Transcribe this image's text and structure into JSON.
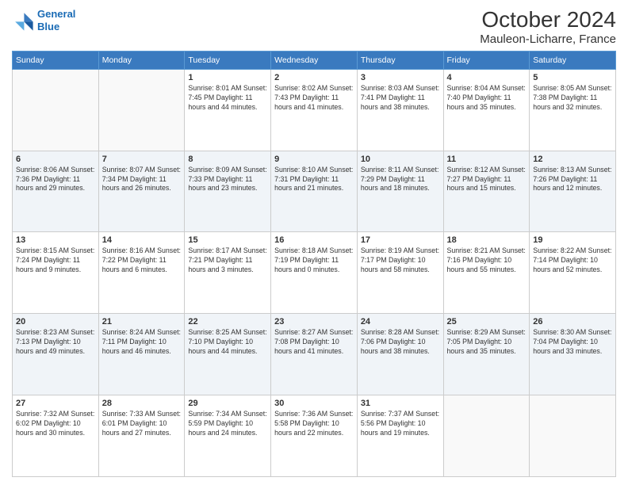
{
  "logo": {
    "line1": "General",
    "line2": "Blue"
  },
  "title": "October 2024",
  "subtitle": "Mauleon-Licharre, France",
  "days_of_week": [
    "Sunday",
    "Monday",
    "Tuesday",
    "Wednesday",
    "Thursday",
    "Friday",
    "Saturday"
  ],
  "weeks": [
    [
      {
        "day": "",
        "detail": ""
      },
      {
        "day": "",
        "detail": ""
      },
      {
        "day": "1",
        "detail": "Sunrise: 8:01 AM\nSunset: 7:45 PM\nDaylight: 11 hours and 44 minutes."
      },
      {
        "day": "2",
        "detail": "Sunrise: 8:02 AM\nSunset: 7:43 PM\nDaylight: 11 hours and 41 minutes."
      },
      {
        "day": "3",
        "detail": "Sunrise: 8:03 AM\nSunset: 7:41 PM\nDaylight: 11 hours and 38 minutes."
      },
      {
        "day": "4",
        "detail": "Sunrise: 8:04 AM\nSunset: 7:40 PM\nDaylight: 11 hours and 35 minutes."
      },
      {
        "day": "5",
        "detail": "Sunrise: 8:05 AM\nSunset: 7:38 PM\nDaylight: 11 hours and 32 minutes."
      }
    ],
    [
      {
        "day": "6",
        "detail": "Sunrise: 8:06 AM\nSunset: 7:36 PM\nDaylight: 11 hours and 29 minutes."
      },
      {
        "day": "7",
        "detail": "Sunrise: 8:07 AM\nSunset: 7:34 PM\nDaylight: 11 hours and 26 minutes."
      },
      {
        "day": "8",
        "detail": "Sunrise: 8:09 AM\nSunset: 7:33 PM\nDaylight: 11 hours and 23 minutes."
      },
      {
        "day": "9",
        "detail": "Sunrise: 8:10 AM\nSunset: 7:31 PM\nDaylight: 11 hours and 21 minutes."
      },
      {
        "day": "10",
        "detail": "Sunrise: 8:11 AM\nSunset: 7:29 PM\nDaylight: 11 hours and 18 minutes."
      },
      {
        "day": "11",
        "detail": "Sunrise: 8:12 AM\nSunset: 7:27 PM\nDaylight: 11 hours and 15 minutes."
      },
      {
        "day": "12",
        "detail": "Sunrise: 8:13 AM\nSunset: 7:26 PM\nDaylight: 11 hours and 12 minutes."
      }
    ],
    [
      {
        "day": "13",
        "detail": "Sunrise: 8:15 AM\nSunset: 7:24 PM\nDaylight: 11 hours and 9 minutes."
      },
      {
        "day": "14",
        "detail": "Sunrise: 8:16 AM\nSunset: 7:22 PM\nDaylight: 11 hours and 6 minutes."
      },
      {
        "day": "15",
        "detail": "Sunrise: 8:17 AM\nSunset: 7:21 PM\nDaylight: 11 hours and 3 minutes."
      },
      {
        "day": "16",
        "detail": "Sunrise: 8:18 AM\nSunset: 7:19 PM\nDaylight: 11 hours and 0 minutes."
      },
      {
        "day": "17",
        "detail": "Sunrise: 8:19 AM\nSunset: 7:17 PM\nDaylight: 10 hours and 58 minutes."
      },
      {
        "day": "18",
        "detail": "Sunrise: 8:21 AM\nSunset: 7:16 PM\nDaylight: 10 hours and 55 minutes."
      },
      {
        "day": "19",
        "detail": "Sunrise: 8:22 AM\nSunset: 7:14 PM\nDaylight: 10 hours and 52 minutes."
      }
    ],
    [
      {
        "day": "20",
        "detail": "Sunrise: 8:23 AM\nSunset: 7:13 PM\nDaylight: 10 hours and 49 minutes."
      },
      {
        "day": "21",
        "detail": "Sunrise: 8:24 AM\nSunset: 7:11 PM\nDaylight: 10 hours and 46 minutes."
      },
      {
        "day": "22",
        "detail": "Sunrise: 8:25 AM\nSunset: 7:10 PM\nDaylight: 10 hours and 44 minutes."
      },
      {
        "day": "23",
        "detail": "Sunrise: 8:27 AM\nSunset: 7:08 PM\nDaylight: 10 hours and 41 minutes."
      },
      {
        "day": "24",
        "detail": "Sunrise: 8:28 AM\nSunset: 7:06 PM\nDaylight: 10 hours and 38 minutes."
      },
      {
        "day": "25",
        "detail": "Sunrise: 8:29 AM\nSunset: 7:05 PM\nDaylight: 10 hours and 35 minutes."
      },
      {
        "day": "26",
        "detail": "Sunrise: 8:30 AM\nSunset: 7:04 PM\nDaylight: 10 hours and 33 minutes."
      }
    ],
    [
      {
        "day": "27",
        "detail": "Sunrise: 7:32 AM\nSunset: 6:02 PM\nDaylight: 10 hours and 30 minutes."
      },
      {
        "day": "28",
        "detail": "Sunrise: 7:33 AM\nSunset: 6:01 PM\nDaylight: 10 hours and 27 minutes."
      },
      {
        "day": "29",
        "detail": "Sunrise: 7:34 AM\nSunset: 5:59 PM\nDaylight: 10 hours and 24 minutes."
      },
      {
        "day": "30",
        "detail": "Sunrise: 7:36 AM\nSunset: 5:58 PM\nDaylight: 10 hours and 22 minutes."
      },
      {
        "day": "31",
        "detail": "Sunrise: 7:37 AM\nSunset: 5:56 PM\nDaylight: 10 hours and 19 minutes."
      },
      {
        "day": "",
        "detail": ""
      },
      {
        "day": "",
        "detail": ""
      }
    ]
  ]
}
